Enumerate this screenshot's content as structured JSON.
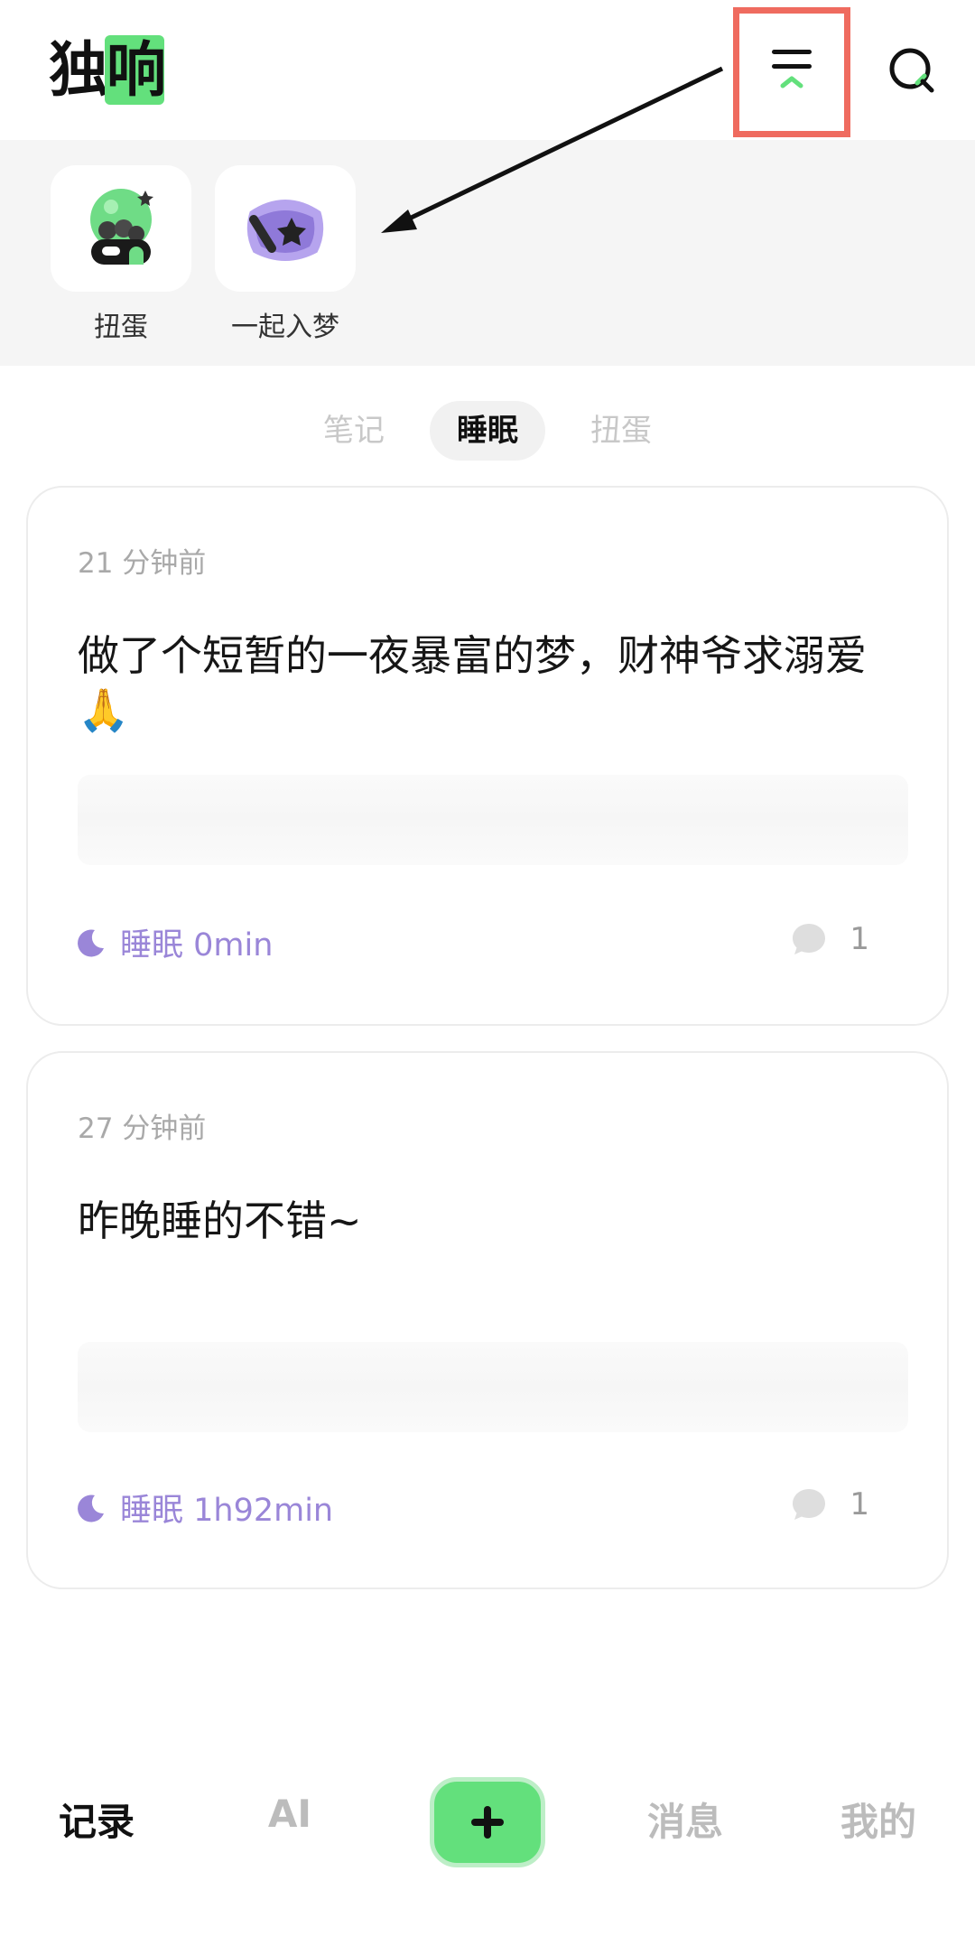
{
  "header": {
    "logo_text": "独响",
    "logo_main": "独",
    "logo_accent": "响"
  },
  "shortcuts": [
    {
      "label": "扭蛋",
      "icon": "gacha-capsule-icon"
    },
    {
      "label": "一起入梦",
      "icon": "pillow-icon"
    }
  ],
  "tabs": [
    {
      "label": "笔记",
      "active": false
    },
    {
      "label": "睡眠",
      "active": true
    },
    {
      "label": "扭蛋",
      "active": false
    }
  ],
  "posts": [
    {
      "time": "21 分钟前",
      "text": "做了个短暂的一夜暴富的梦，财神爷求溺爱🙏",
      "sleep": "睡眠 0min",
      "comments": "1"
    },
    {
      "time": "27 分钟前",
      "text": "昨晚睡的不错~",
      "sleep": "睡眠 1h92min",
      "comments": "1"
    }
  ],
  "bottom_nav": {
    "records": "记录",
    "ai": "AI",
    "messages": "消息",
    "mine": "我的"
  },
  "colors": {
    "accent_green": "#63e07c",
    "sleep_purple": "#9a86d8",
    "highlight_red": "#ef6b5f"
  }
}
